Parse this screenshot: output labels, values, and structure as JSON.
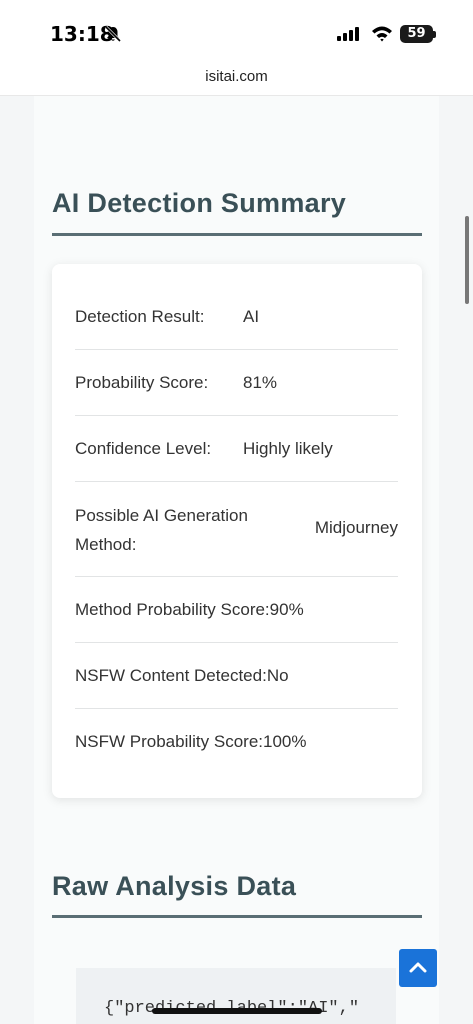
{
  "status_bar": {
    "time": "13:18",
    "battery": "59"
  },
  "browser": {
    "url": "isitai.com"
  },
  "summary": {
    "title": "AI Detection Summary",
    "rows": [
      {
        "label": "Detection Result:",
        "value": "AI"
      },
      {
        "label": "Probability Score:",
        "value": "81%"
      },
      {
        "label": "Confidence Level:",
        "value": "Highly likely"
      },
      {
        "label": "Possible AI Generation Method:",
        "value": "Midjourney"
      },
      {
        "label": "Method Probability Score:",
        "value": "90%"
      },
      {
        "label": "NSFW Content Detected:",
        "value": "No"
      },
      {
        "label": "NSFW Probability Score:",
        "value": "100%"
      }
    ]
  },
  "raw": {
    "title": "Raw Analysis Data",
    "code_line": "{\"predicted_label\":\"AI\",\""
  },
  "colors": {
    "heading": "#3a5057",
    "accent_button": "#1a73d9"
  },
  "icons": [
    "bell-slash-icon",
    "signal-icon",
    "wifi-icon",
    "battery-icon",
    "chevron-up-icon"
  ]
}
